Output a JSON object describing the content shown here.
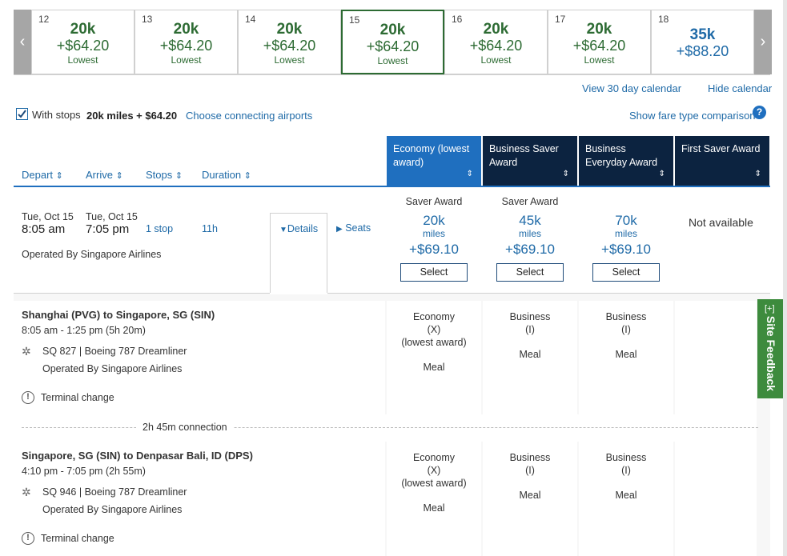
{
  "calendar": {
    "days": [
      {
        "day": "12",
        "miles": "20k",
        "tax": "+$64.20",
        "note": "Lowest"
      },
      {
        "day": "13",
        "miles": "20k",
        "tax": "+$64.20",
        "note": "Lowest"
      },
      {
        "day": "14",
        "miles": "20k",
        "tax": "+$64.20",
        "note": "Lowest"
      },
      {
        "day": "15",
        "miles": "20k",
        "tax": "+$64.20",
        "note": "Lowest"
      },
      {
        "day": "16",
        "miles": "20k",
        "tax": "+$64.20",
        "note": "Lowest"
      },
      {
        "day": "17",
        "miles": "20k",
        "tax": "+$64.20",
        "note": "Lowest"
      },
      {
        "day": "18",
        "miles": "35k",
        "tax": "+$88.20",
        "note": ""
      }
    ],
    "prev_arrow": "‹",
    "next_arrow": "›",
    "view30": "View 30 day calendar",
    "hide": "Hide calendar"
  },
  "filter": {
    "with_stops_label": "With stops",
    "with_stops_checked": true,
    "price": "20k miles + $64.20",
    "connecting": "Choose connecting airports",
    "fare_compare": "Show fare type comparison",
    "help": "?"
  },
  "columns": {
    "depart": "Depart",
    "arrive": "Arrive",
    "stops": "Stops",
    "duration": "Duration",
    "sort_glyph": "⇕"
  },
  "fare_types": [
    {
      "label": "Economy (lowest award)"
    },
    {
      "label": "Business Saver Award"
    },
    {
      "label": "Business Everyday Award"
    },
    {
      "label": "First Saver Award"
    }
  ],
  "flight": {
    "depart_date": "Tue, Oct 15",
    "depart_time": "8:05 am",
    "arrive_date": "Tue, Oct 15",
    "arrive_time": "7:05 pm",
    "stops": "1 stop",
    "duration": "11h",
    "details": "Details",
    "seats": "Seats",
    "operated": "Operated By Singapore Airlines",
    "fares": [
      {
        "type": "Saver Award",
        "miles": "20k",
        "unit": "miles",
        "tax": "+$69.10",
        "select": "Select"
      },
      {
        "type": "Saver Award",
        "miles": "45k",
        "unit": "miles",
        "tax": "+$69.10",
        "select": "Select"
      },
      {
        "type": "",
        "miles": "70k",
        "unit": "miles",
        "tax": "+$69.10",
        "select": "Select"
      }
    ],
    "first_status": "Not available"
  },
  "segments": [
    {
      "route": "Shanghai (PVG) to Singapore, SG (SIN)",
      "times": "8:05 am - 1:25 pm (5h 20m)",
      "flight": "SQ 827",
      "aircraft": "Boeing 787 Dreamliner",
      "operated": "Operated By Singapore Airlines",
      "terminal": "Terminal change",
      "cabins": [
        {
          "name": "Economy",
          "code": "(X)",
          "extra": "(lowest award)",
          "meal": "Meal"
        },
        {
          "name": "Business",
          "code": "(I)",
          "extra": "",
          "meal": "Meal"
        },
        {
          "name": "Business",
          "code": "(I)",
          "extra": "",
          "meal": "Meal"
        }
      ]
    },
    {
      "route": "Singapore, SG (SIN) to Denpasar Bali, ID (DPS)",
      "times": "4:10 pm - 7:05 pm (2h 55m)",
      "flight": "SQ 946",
      "aircraft": "Boeing 787 Dreamliner",
      "operated": "Operated By Singapore Airlines",
      "terminal": "Terminal change",
      "cabins": [
        {
          "name": "Economy",
          "code": "(X)",
          "extra": "(lowest award)",
          "meal": "Meal"
        },
        {
          "name": "Business",
          "code": "(I)",
          "extra": "",
          "meal": "Meal"
        },
        {
          "name": "Business",
          "code": "(I)",
          "extra": "",
          "meal": "Meal"
        }
      ]
    }
  ],
  "connection": "2h 45m connection",
  "feedback": {
    "plus": "[+]",
    "label": "Site Feedback"
  },
  "colors": {
    "green": "#2d6b33",
    "navy": "#0c2340",
    "active_blue": "#1f6fbf",
    "link": "#1f6aa7"
  }
}
